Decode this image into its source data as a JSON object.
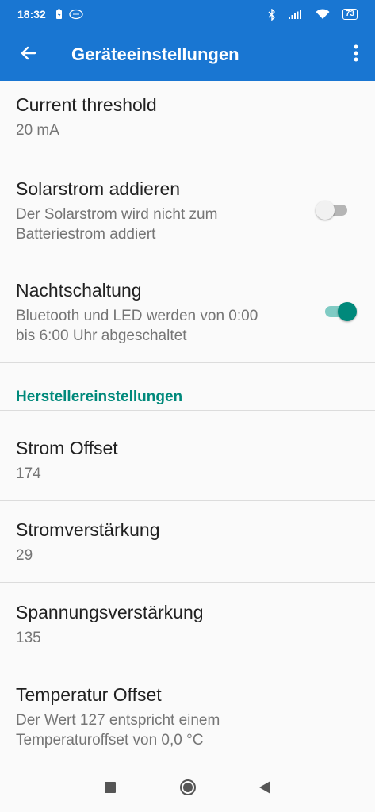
{
  "status_bar": {
    "time": "18:32",
    "battery": "73"
  },
  "app_bar": {
    "title": "Geräteeinstellungen",
    "back_icon": "arrow-left-icon",
    "menu_icon": "more-vert-icon"
  },
  "settings": {
    "current_threshold": {
      "title": "Current threshold",
      "summary": "20 mA"
    },
    "solar_add": {
      "title": "Solarstrom addieren",
      "summary_line1": "Der Solarstrom wird nicht zum",
      "summary_line2": "Batteriestrom addiert",
      "enabled": false
    },
    "night_mode": {
      "title": "Nachtschaltung",
      "summary_line1": "Bluetooth und LED werden von 0:00",
      "summary_line2": "bis 6:00 Uhr abgeschaltet",
      "enabled": true
    }
  },
  "manufacturer": {
    "category": "Herstellereinstellungen",
    "strom_offset": {
      "title": "Strom Offset",
      "value": "174"
    },
    "strom_gain": {
      "title": "Stromverstärkung",
      "value": "29"
    },
    "voltage_gain": {
      "title": "Spannungsverstärkung",
      "value": "135"
    },
    "temp_offset": {
      "title": "Temperatur Offset",
      "summary_line1": "Der Wert 127 entspricht einem",
      "summary_line2": "Temperaturoffset von 0,0 °C"
    }
  },
  "colors": {
    "primary": "#1976d2",
    "accent": "#00897b"
  }
}
